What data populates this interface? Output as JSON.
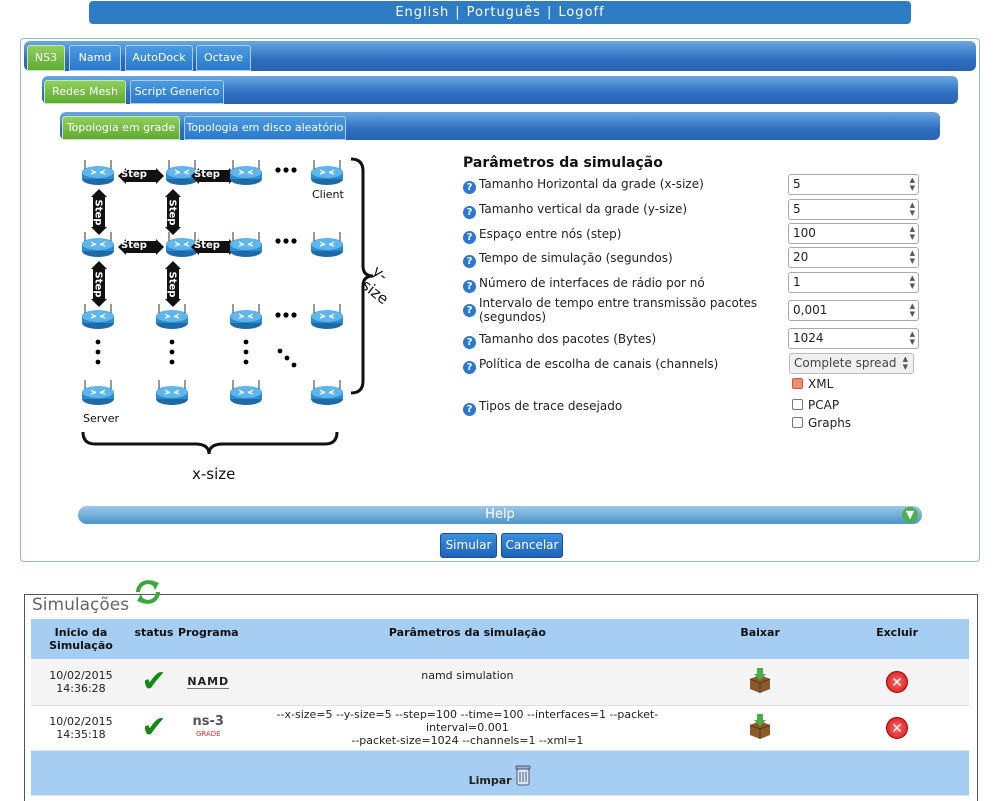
{
  "language_bar": {
    "english": "English",
    "portugues": "Português",
    "logoff": "Logoff"
  },
  "tabs_level1": [
    "NS3",
    "Namd",
    "AutoDock",
    "Octave"
  ],
  "tabs_level2": [
    "Redes Mesh",
    "Script Generico"
  ],
  "tabs_level3": [
    "Topologia em grade",
    "Topologia em disco aleatório"
  ],
  "diagram": {
    "step": "Step",
    "client": "Client",
    "server": "Server",
    "y_size": "y-size",
    "x_size": "x-size"
  },
  "parameters": {
    "title": "Parâmetros da simulação",
    "rows": [
      {
        "label": "Tamanho Horizontal da grade (x-size)",
        "value": "5"
      },
      {
        "label": "Tamanho vertical da grade (y-size)",
        "value": "5"
      },
      {
        "label": "Espaço entre nós (step)",
        "value": "100"
      },
      {
        "label": "Tempo de simulação (segundos)",
        "value": "20"
      },
      {
        "label": "Número de interfaces de rádio por nó",
        "value": "1"
      },
      {
        "label": "Intervalo de tempo entre transmissão pacotes (segundos)",
        "value": "0,001"
      },
      {
        "label": "Tamanho dos pacotes (Bytes)",
        "value": "1024"
      }
    ],
    "channels_label": "Política de escolha de canais (channels)",
    "channels_value": "Complete spread",
    "trace_label": "Tipos de trace desejado",
    "trace_options": [
      {
        "label": "XML",
        "checked": true
      },
      {
        "label": "PCAP",
        "checked": false
      },
      {
        "label": "Graphs",
        "checked": false
      }
    ]
  },
  "help": {
    "label": "Help"
  },
  "actions": {
    "simulate": "Simular",
    "cancel": "Cancelar"
  },
  "simulations": {
    "title": "Simulações",
    "headers": {
      "start_line1": "Inicio da",
      "start_line2": "Simulação",
      "status": "status",
      "program": "Programa",
      "params": "Parâmetros da simulação",
      "download": "Baixar",
      "delete": "Excluir"
    },
    "rows": [
      {
        "date": "10/02/2015",
        "time": "14:36:28",
        "program": "NAMD",
        "params_line1": "namd simulation",
        "params_line2": ""
      },
      {
        "date": "10/02/2015",
        "time": "14:35:18",
        "program": "ns-3",
        "program_sub": "GRADE",
        "params_line1": "--x-size=5 --y-size=5 --step=100 --time=100 --interfaces=1 --packet-interval=0.001",
        "params_line2": "--packet-size=1024 --channels=1 --xml=1"
      }
    ],
    "clear": "Limpar"
  },
  "colors": {
    "tab_blue": "#2f6fc0",
    "tab_active_green": "#5faa33",
    "header_blue": "#a6cdf2",
    "check_green": "#128a12",
    "delete_red": "#d01414"
  }
}
